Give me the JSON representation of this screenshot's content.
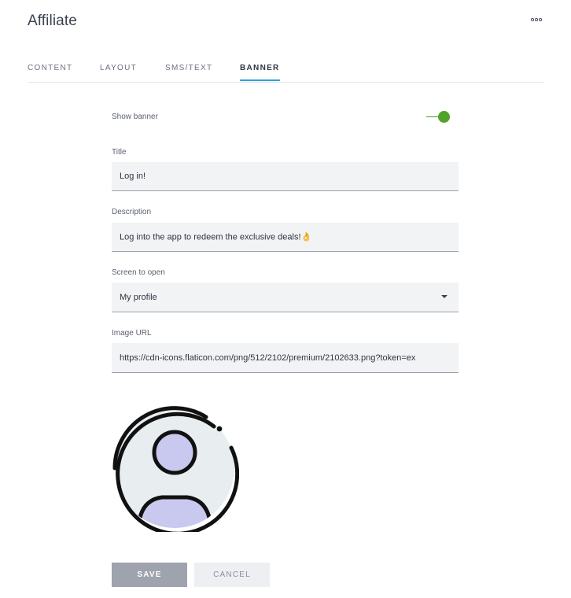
{
  "page": {
    "title": "Affiliate",
    "more_icon": "ellipsis-icon"
  },
  "tabs": [
    {
      "label": "CONTENT",
      "active": false
    },
    {
      "label": "LAYOUT",
      "active": false
    },
    {
      "label": "SMS/TEXT",
      "active": false
    },
    {
      "label": "BANNER",
      "active": true
    }
  ],
  "form": {
    "show_banner": {
      "label": "Show banner",
      "enabled": true
    },
    "title": {
      "label": "Title",
      "value": "Log in!"
    },
    "description": {
      "label": "Description",
      "value": "Log into the app to redeem the exclusive deals!👌"
    },
    "screen_to_open": {
      "label": "Screen to open",
      "value": "My profile"
    },
    "image_url": {
      "label": "Image URL",
      "value": "https://cdn-icons.flaticon.com/png/512/2102/premium/2102633.png?token=ex"
    }
  },
  "preview": {
    "icon": "user-profile-icon"
  },
  "buttons": {
    "save": "SAVE",
    "cancel": "CANCEL"
  },
  "colors": {
    "accent": "#2aa3d6",
    "toggle_on": "#52a22a",
    "avatar_bg": "#e8eef0",
    "avatar_person": "#c9c8ef"
  }
}
